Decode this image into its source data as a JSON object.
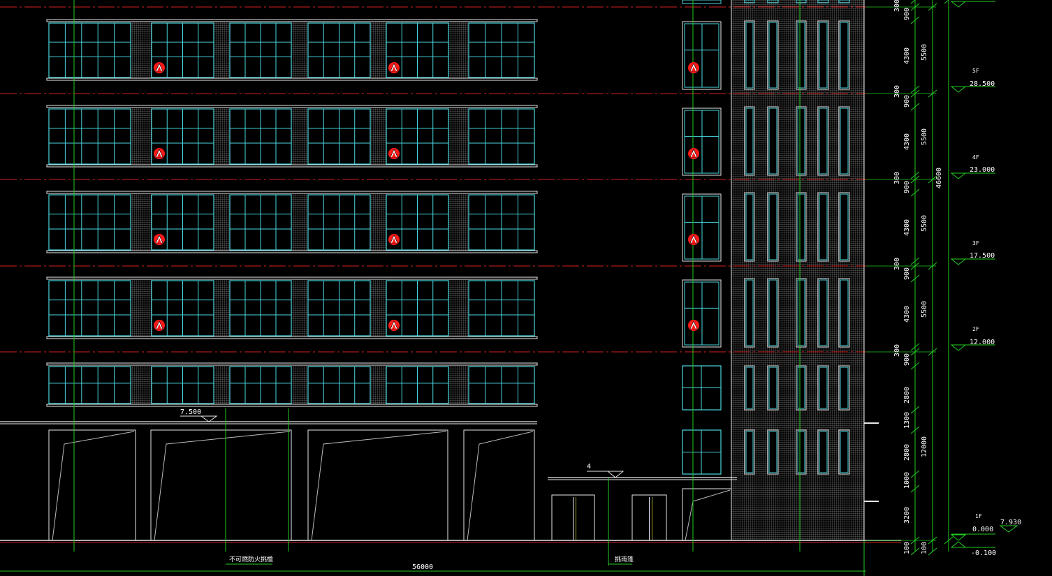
{
  "colors": {
    "background": "#000000",
    "window": "#4ad8e0",
    "outline": "#e8e8e8",
    "axis": "#22cc22",
    "level_line": "#d42020",
    "marker": "#ff1a1a",
    "text": "#ffffff"
  },
  "level_markers": [
    {
      "floor": "5F",
      "elevation": "28.500"
    },
    {
      "floor": "4F",
      "elevation": "23.000"
    },
    {
      "floor": "3F",
      "elevation": "17.500"
    },
    {
      "floor": "2F",
      "elevation": "12.000"
    },
    {
      "floor": "1F",
      "elevation": "0.000"
    }
  ],
  "other_elevations": {
    "canopy": "7.500",
    "ground": "-0.100",
    "right_mark": "7.930",
    "porch_mark": "4"
  },
  "dims_inner": [
    "300",
    "900",
    "4300",
    "300",
    "900",
    "4300",
    "300",
    "900",
    "4300",
    "300",
    "900",
    "4300",
    "300",
    "900",
    "2800",
    "1300",
    "2800",
    "1000",
    "3200",
    "100"
  ],
  "dims_middle": [
    "5500",
    "5500",
    "5500",
    "5500",
    "12000",
    "100"
  ],
  "dims_total": "46600",
  "total_width": "56000",
  "labels": {
    "fire_opening": "不可燃防火挑檐",
    "rain_canopy": "挑雨篷"
  }
}
